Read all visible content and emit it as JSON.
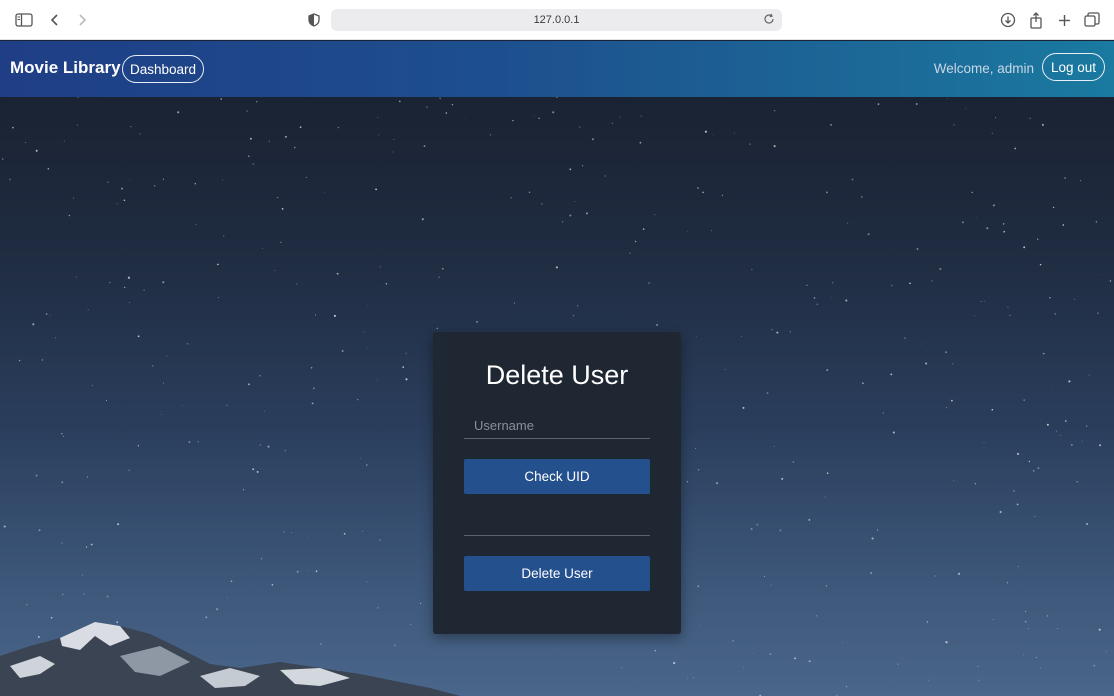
{
  "browser": {
    "url": "127.0.0.1"
  },
  "nav": {
    "brand": "Movie Library",
    "dashboard_label": "Dashboard",
    "welcome_text": "Welcome, admin",
    "logout_label": "Log out"
  },
  "form": {
    "title": "Delete User",
    "username_placeholder": "Username",
    "username_value": "",
    "check_uid_label": "Check UID",
    "uid_value": "",
    "delete_label": "Delete User"
  },
  "colors": {
    "nav_gradient_start": "#1f3e85",
    "nav_gradient_end": "#1a7aa0",
    "button_blue": "#24508e",
    "card_bg": "#1f2733"
  }
}
